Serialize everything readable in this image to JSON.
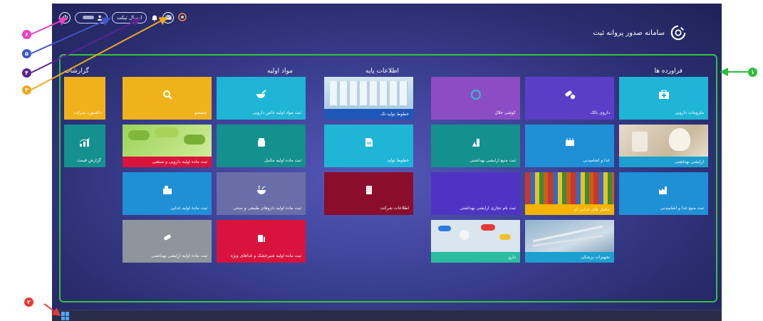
{
  "app": {
    "title": "سامانه صدور پروانه ثبت"
  },
  "topbar": {
    "ticket_label": "ارسال تیکت",
    "user_label": "",
    "power_icon": "power-icon",
    "user_icon": "user-icon",
    "bell_icon": "bell-icon",
    "mail_icon": "mail-icon",
    "logo_icon": "brand-logo-icon"
  },
  "sections": {
    "products": "فراورده ها",
    "basic_info": "اطلاعات پایه",
    "raw_materials": "مواد اولیه",
    "reports": "گزارشات"
  },
  "tiles": {
    "cosmetics": "آرایشی بهداشتی",
    "medical_supplies": "ملزومات دارویی",
    "drug_bulk": "داروی بالک",
    "halal_cosmetic": "کوشی حلال",
    "health_source": "ثبت منبع غذا و آشامیدنی",
    "food_drinks": "غذا و آشامیدنی",
    "cosmetic_source": "ثبت منبع آرایشی بهداشتی",
    "supplements": "مکمل های غذایی ای",
    "trade_name": "ثبت نام تجاری آرایشی بهداشتی",
    "medical_equipment": "تجهیزات پزشکی",
    "drug": "دارو",
    "production_lines_single": "خطوط تولید-تک",
    "production_lines": "خطوط تولید",
    "company_info": "اطلاعات شرکت",
    "raw_drug_register": "ثبت مواد اولیه خاص دارویی",
    "search": "جستجو",
    "raw_supplement": "ثبت ماده اولیه مکمل",
    "raw_pharma_industrial": "ثبت ماده اولیه دارویی و صنعتی",
    "raw_natural": "ثبت ماده اولیه داروهای طبیعی و سنتی",
    "raw_food": "ثبت ماده اولیه غذایی",
    "raw_cosmetic": "ثبت ماده اولیه آرایشی بهداشتی",
    "raw_milk": "ثبت ماده اولیه شیرخشک و غذاهای ویژه",
    "company_dashboard": "داشبورد شرکت",
    "price_report": "گزارش قیمت"
  },
  "callouts": {
    "n1": "۱",
    "n2": "۲",
    "n3": "۳",
    "n4": "۴",
    "n5": "۵",
    "n6": "۶"
  },
  "colors": {
    "frame_green": "#35c23e",
    "callout1": "#2dbd3a",
    "callout2": "#e53935",
    "callout3": "#f0a81c",
    "callout4": "#5a2390",
    "callout5": "#3d57c7",
    "callout6": "#e93fc3"
  }
}
